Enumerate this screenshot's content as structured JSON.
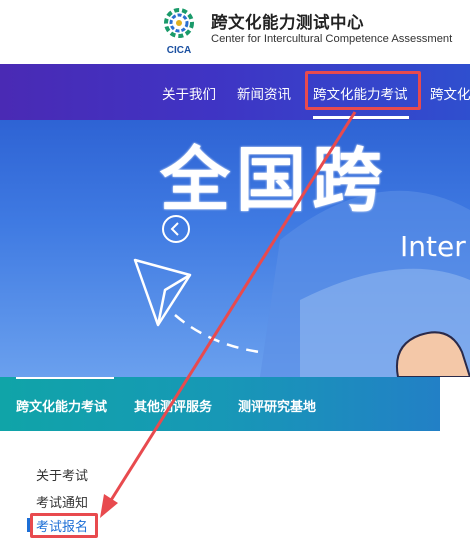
{
  "header": {
    "title": "跨文化能力测试中心",
    "subtitle": "Center for Intercultural Competence Assessment",
    "logo_text": "CICA"
  },
  "nav": {
    "items": [
      "关于我们",
      "新闻资讯",
      "跨文化能力考试",
      "跨文化"
    ],
    "highlighted": "跨文化能力考试"
  },
  "banner": {
    "title": "全国跨",
    "subtitle": "Inter",
    "prev_icon": "chevron-left-icon"
  },
  "tabs": [
    "跨文化能力考试",
    "其他测评服务",
    "测评研究基地"
  ],
  "sidebar": {
    "items": [
      "关于考试",
      "考试通知",
      "考试报名"
    ],
    "active": "考试报名"
  },
  "colors": {
    "annotation": "#e84a4e",
    "nav_bg": "#4030bf",
    "tab_bg": "#1598b2",
    "active_link": "#1d6fd6"
  }
}
